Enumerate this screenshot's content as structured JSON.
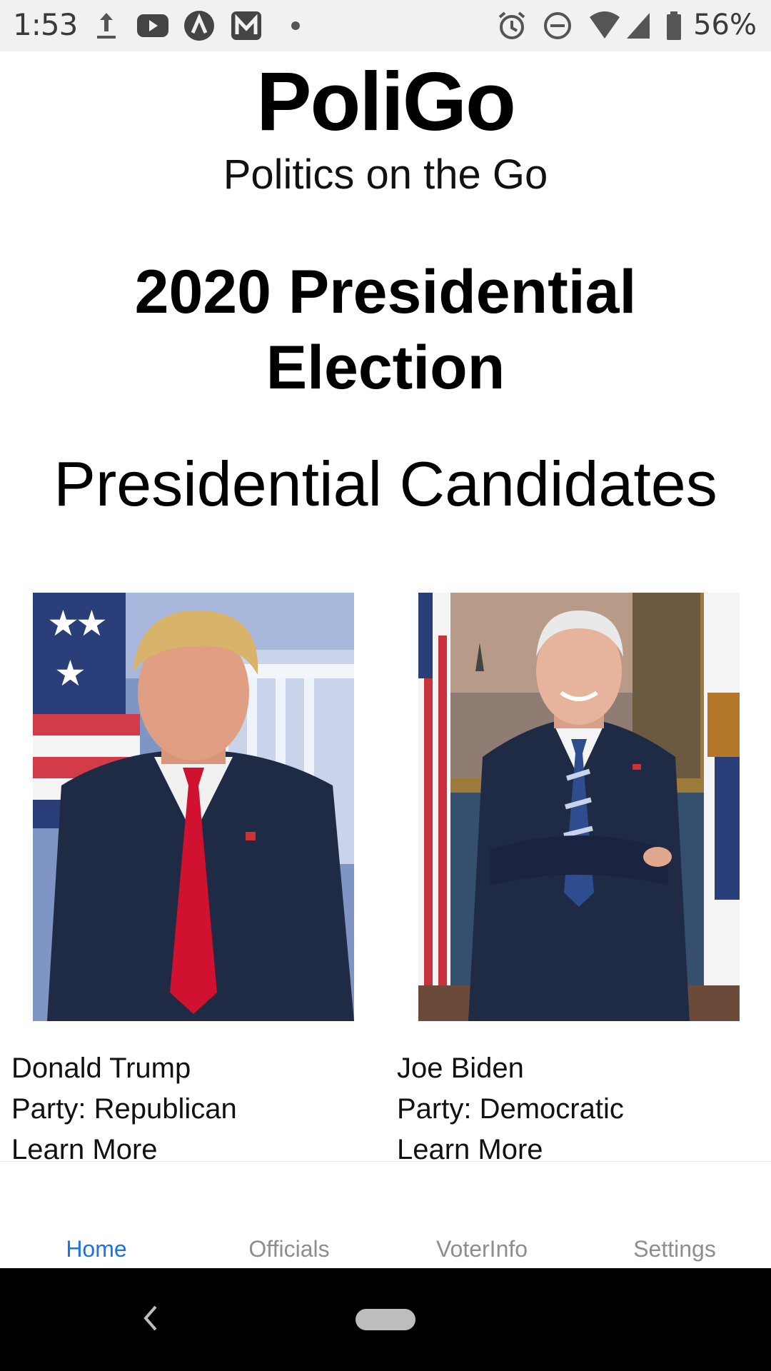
{
  "status_bar": {
    "time": "1:53",
    "battery": "56%",
    "icons": [
      "upload-icon",
      "youtube-icon",
      "app-a-icon",
      "app-m-icon",
      "notification-dot-icon",
      "alarm-icon",
      "do-not-disturb-icon",
      "wifi-icon",
      "cell-signal-icon",
      "battery-icon"
    ]
  },
  "header": {
    "app_title": "PoliGo",
    "app_subtitle": "Politics on the Go"
  },
  "election": {
    "title": "2020 Presidential Election"
  },
  "section": {
    "title": "Presidential Candidates"
  },
  "candidates": [
    {
      "name": "Donald Trump",
      "party": "Party: Republican",
      "link": "Learn More"
    },
    {
      "name": "Joe Biden",
      "party": "Party: Democratic",
      "link": "Learn More"
    }
  ],
  "tabs": [
    {
      "label": "Home",
      "active": true
    },
    {
      "label": "Officials",
      "active": false
    },
    {
      "label": "VoterInfo",
      "active": false
    },
    {
      "label": "Settings",
      "active": false
    }
  ],
  "colors": {
    "active_tab": "#1a73e8",
    "inactive_tab": "#8e8e8e",
    "status_bar_bg": "#f1f1f1",
    "nav_bar_bg": "#000000"
  }
}
